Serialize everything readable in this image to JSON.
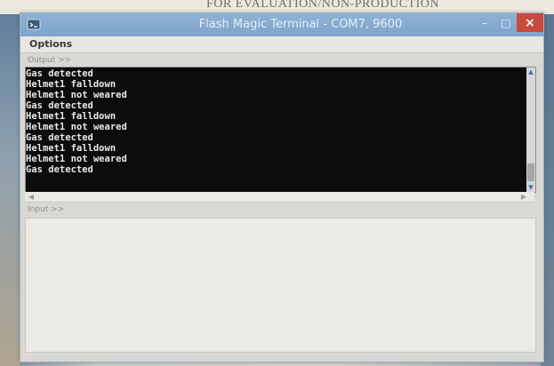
{
  "background_strip": {
    "partial_text": "FOR EVALUATION/NON-PRODUCTION USE ONLY"
  },
  "window": {
    "title": "Flash Magic Terminal - COM7, 9600",
    "controls": {
      "minimize": "–",
      "maximize": "□",
      "close": "×"
    }
  },
  "menu": {
    "options_label": "Options"
  },
  "output": {
    "label": "Output >>",
    "lines": [
      "Gas detected",
      "Helmet1 falldown",
      "Helmet1 not weared",
      "Gas detected",
      "Helmet1 falldown",
      "Helmet1 not weared",
      "Gas detected",
      "Helmet1 falldown",
      "Helmet1 not weared",
      "Gas detected"
    ]
  },
  "input": {
    "label": "Input >>",
    "value": ""
  },
  "icons": {
    "app": "terminal-app-icon",
    "scroll_up": "scroll-up-icon",
    "scroll_down": "scroll-down-icon",
    "scroll_left": "scroll-left-icon",
    "scroll_right": "scroll-right-icon"
  },
  "colors": {
    "titlebar": "#8fb2d6",
    "close_button": "#c94a3e",
    "terminal_bg": "#0c0c0c",
    "terminal_text": "#e8e8e8"
  }
}
